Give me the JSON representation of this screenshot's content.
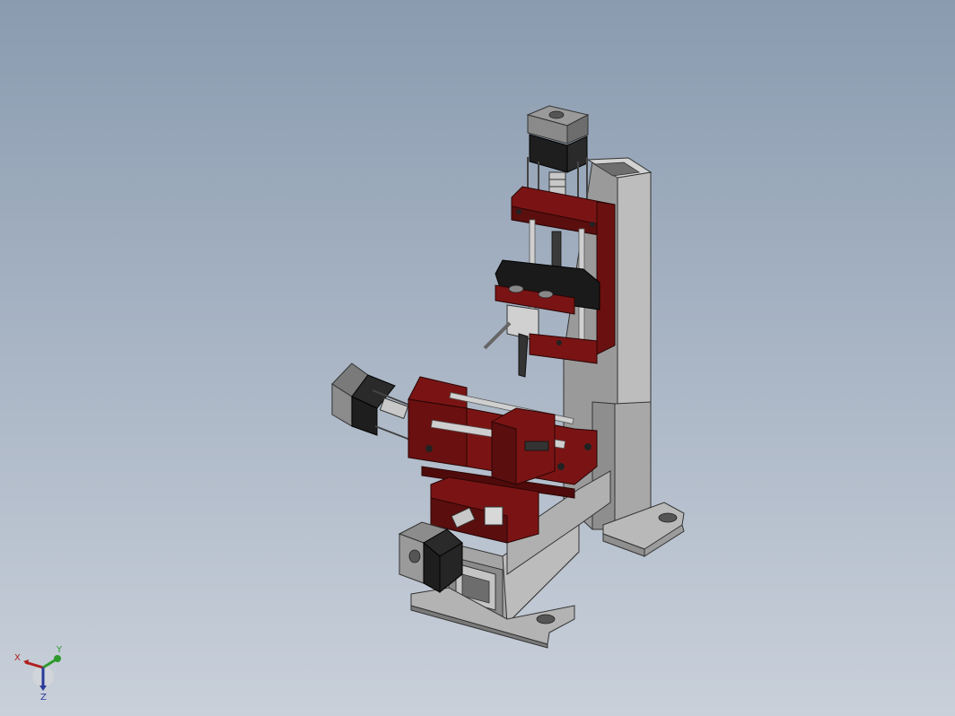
{
  "viewport": {
    "background_top": "#8a9bb0",
    "background_bottom": "#c9d0da"
  },
  "model": {
    "part_colors": {
      "frame": "#a9a9a9",
      "frame_dark": "#7d7d7d",
      "bracket": "#7a1414",
      "bracket_dark": "#4f0b0b",
      "motor": "#1e1e1e",
      "motor_face": "#8c8c8c",
      "rod": "#cfcfcf"
    }
  },
  "triad": {
    "x_label": "X",
    "y_label": "Y",
    "z_label": "Z",
    "x_color": "#b02020",
    "y_color": "#2e9a2e",
    "z_color": "#2a3a9a"
  }
}
